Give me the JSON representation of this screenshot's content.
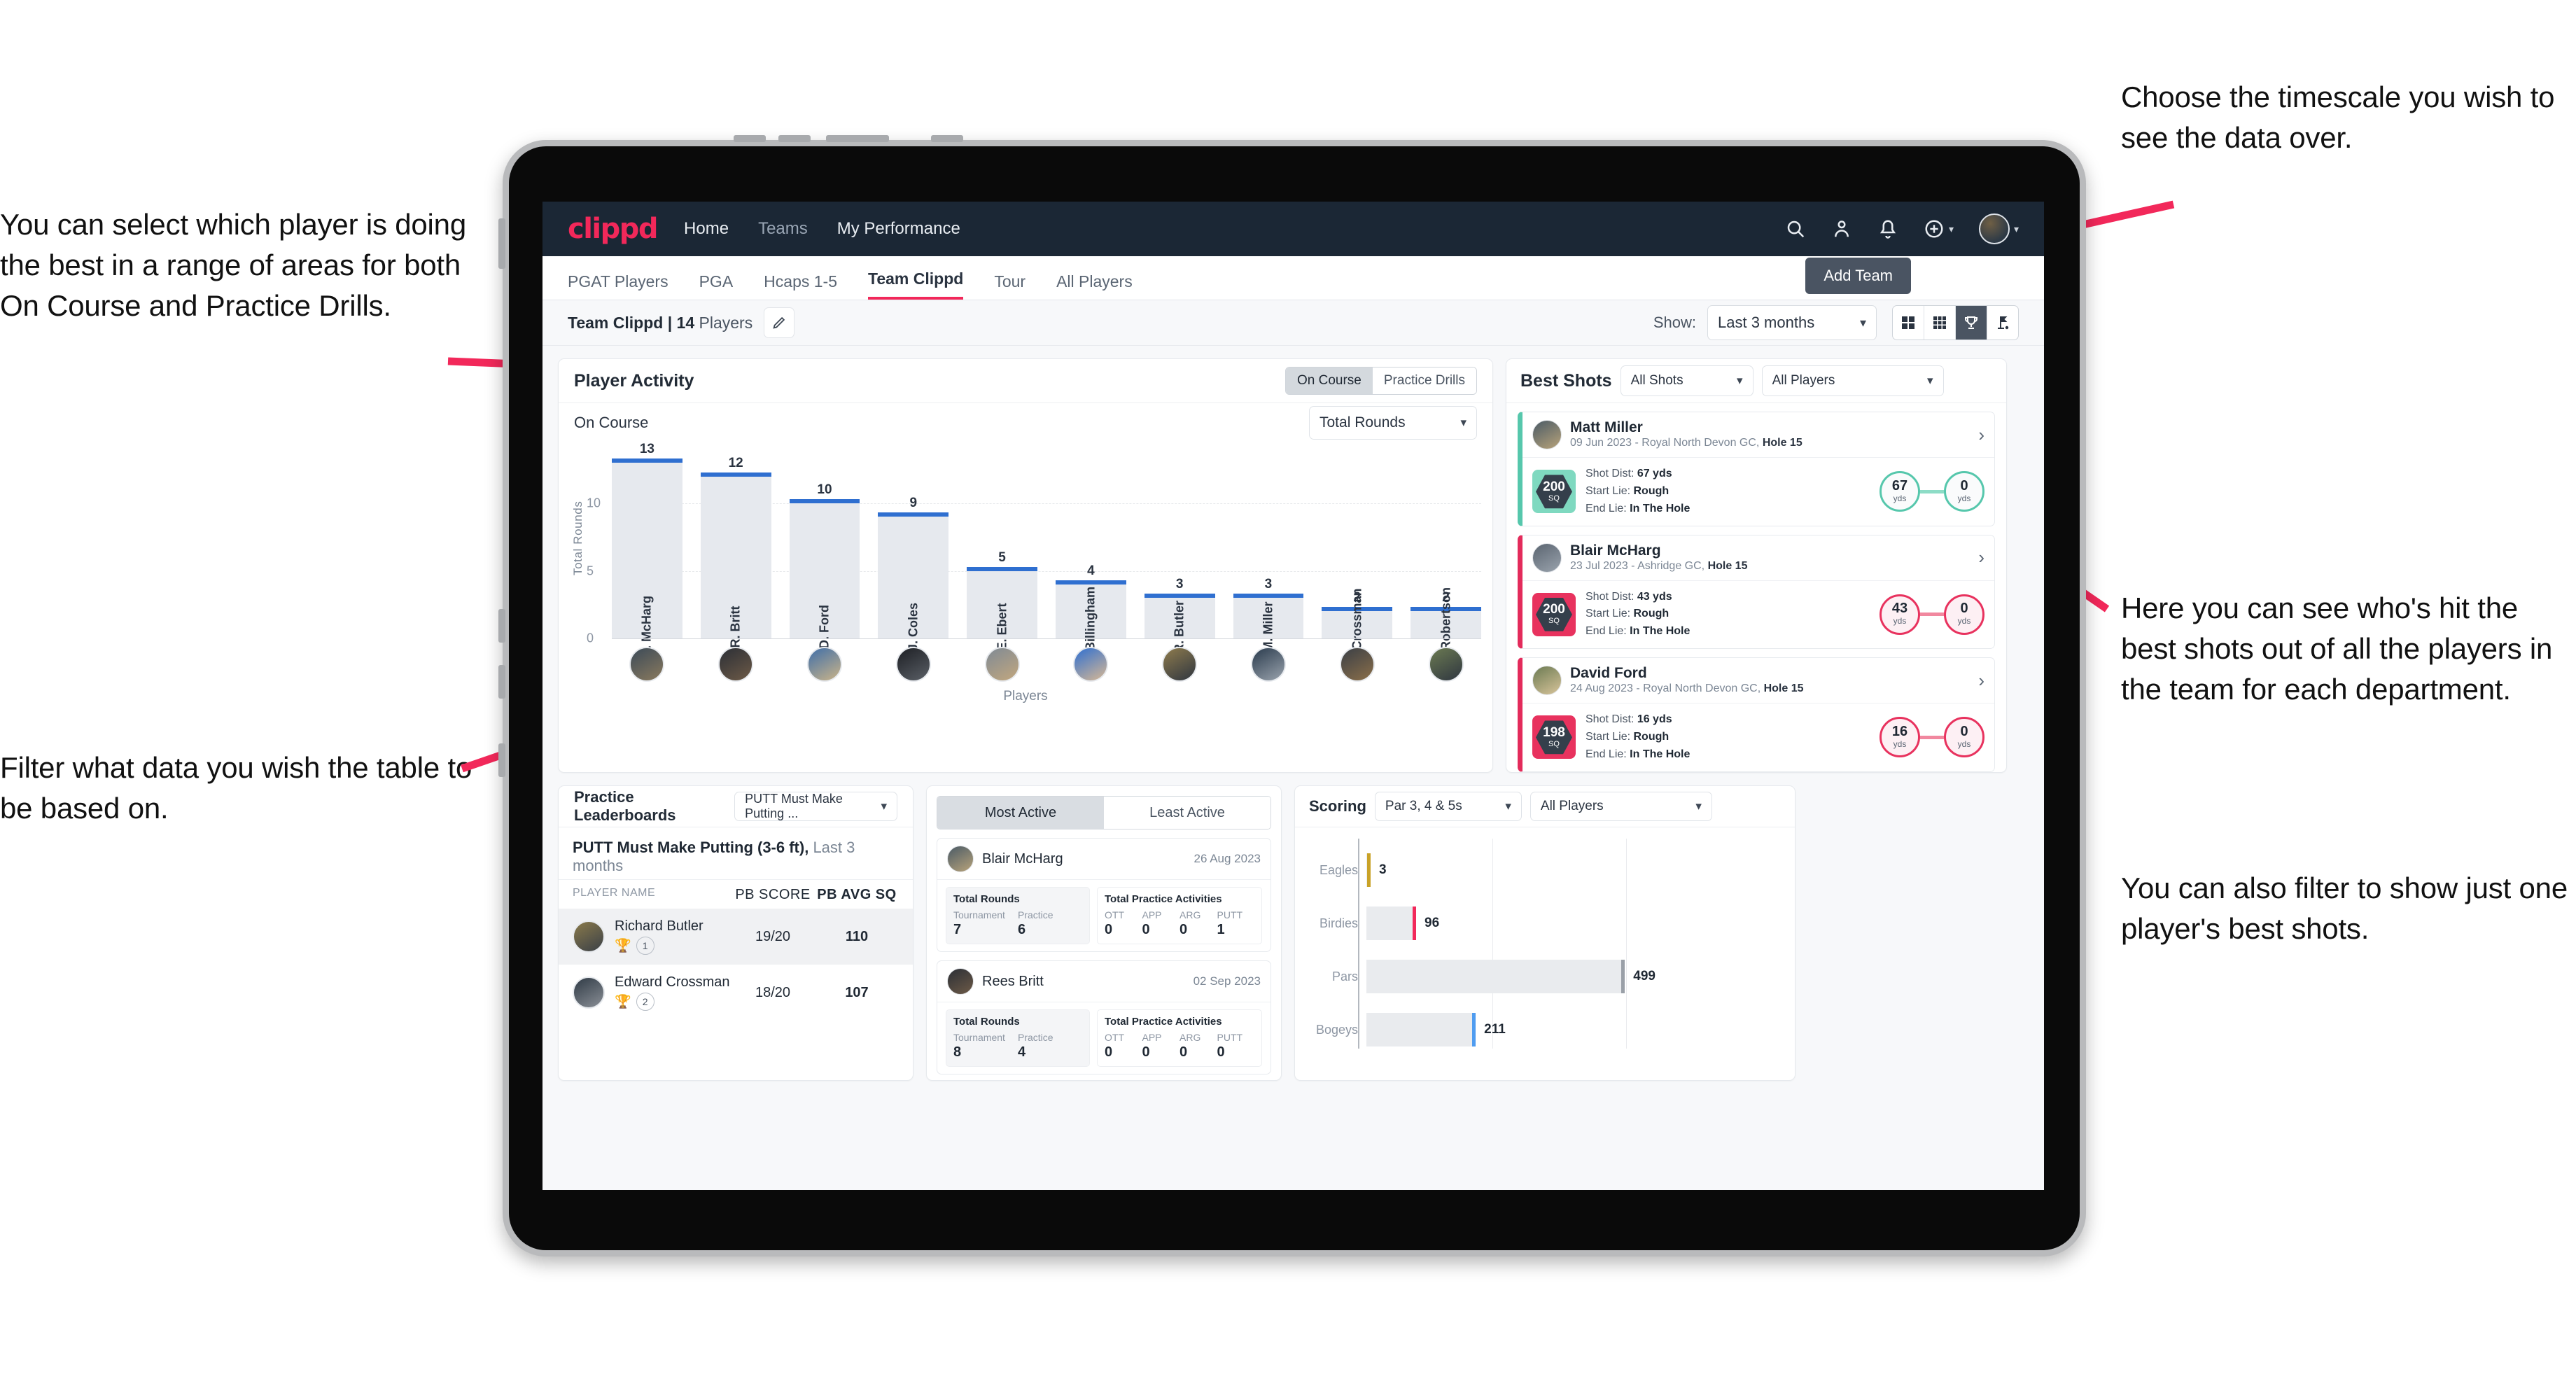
{
  "annotations": {
    "left_top": "You can select which player is doing the best in a range of areas for both On Course and Practice Drills.",
    "left_bottom": "Filter what data you wish the table to be based on.",
    "right_top": "Choose the timescale you wish to see the data over.",
    "right_mid": "Here you can see who's hit the best shots out of all the players in the team for each department.",
    "right_bottom": "You can also filter to show just one player's best shots."
  },
  "topnav": {
    "logo": "clippd",
    "links": [
      {
        "label": "Home",
        "active": true
      },
      {
        "label": "Teams",
        "active": false
      },
      {
        "label": "My Performance",
        "active": true
      }
    ],
    "icons": [
      "search-icon",
      "people-icon",
      "bell-icon",
      "plus-circle-icon",
      "avatar-icon"
    ]
  },
  "tabs": [
    {
      "label": "PGAT Players",
      "active": false
    },
    {
      "label": "PGA",
      "active": false
    },
    {
      "label": "Hcaps 1-5",
      "active": false
    },
    {
      "label": "Team Clippd",
      "active": true
    },
    {
      "label": "Tour",
      "active": false
    },
    {
      "label": "All Players",
      "active": false
    }
  ],
  "add_team_button": "Add Team",
  "team_row": {
    "team_name": "Team Clippd",
    "separator": " | ",
    "player_count": "14",
    "players_word": " Players",
    "edit_icon": "pencil-icon",
    "show_label": "Show:",
    "show_value": "Last 3 months",
    "view_toggles": [
      {
        "icon": "grid-2x2-icon",
        "active": false
      },
      {
        "icon": "grid-3x3-icon",
        "active": false
      },
      {
        "icon": "trophy-icon",
        "active": true
      },
      {
        "icon": "golf-flag-icon",
        "active": false
      }
    ]
  },
  "player_activity": {
    "title": "Player Activity",
    "segments": [
      {
        "label": "On Course",
        "active": true
      },
      {
        "label": "Practice Drills",
        "active": false
      }
    ],
    "sub_label": "On Course",
    "metric_select": "Total Rounds"
  },
  "chart_data": [
    {
      "type": "bar",
      "title": "Player Activity - On Course",
      "xlabel": "Players",
      "ylabel": "Total Rounds",
      "ylim": [
        0,
        13.9
      ],
      "yticks": [
        0,
        5,
        10
      ],
      "grid": true,
      "categories": [
        "B. McHarg",
        "R. Britt",
        "D. Ford",
        "J. Coles",
        "E. Ebert",
        "D. Billingham",
        "R. Butler",
        "M. Miller",
        "E. Crossman",
        "C. Robertson"
      ],
      "values": [
        13,
        12,
        10,
        9,
        5,
        4,
        3,
        3,
        2,
        2
      ]
    },
    {
      "type": "bar",
      "title": "Scoring",
      "orientation": "horizontal",
      "categories": [
        "Eagles",
        "Birdies",
        "Pars",
        "Bogeys"
      ],
      "values": [
        3,
        96,
        499,
        211
      ],
      "colors": [
        "#c9a227",
        "#f2285a",
        "#9aa0a8",
        "#4f9cf0"
      ],
      "xlim": [
        0,
        700
      ]
    }
  ],
  "best_shots": {
    "title": "Best Shots",
    "filter_shots": "All Shots",
    "filter_players": "All Players",
    "cards": [
      {
        "name": "Matt Miller",
        "meta_prefix": "09 Jun 2023 - Royal North Devon GC, ",
        "meta_hole": "Hole 15",
        "sq": "200",
        "sq_unit": "SQ",
        "accent": "teal",
        "shot_dist_label": "Shot Dist: ",
        "shot_dist": "67 yds",
        "start_lie_label": "Start Lie: ",
        "start_lie": "Rough",
        "end_lie_label": "End Lie: ",
        "end_lie": "In The Hole",
        "from_value": "67",
        "from_unit": "yds",
        "to_value": "0",
        "to_unit": "yds"
      },
      {
        "name": "Blair McHarg",
        "meta_prefix": "23 Jul 2023 - Ashridge GC, ",
        "meta_hole": "Hole 15",
        "sq": "200",
        "sq_unit": "SQ",
        "accent": "pink",
        "shot_dist_label": "Shot Dist: ",
        "shot_dist": "43 yds",
        "start_lie_label": "Start Lie: ",
        "start_lie": "Rough",
        "end_lie_label": "End Lie: ",
        "end_lie": "In The Hole",
        "from_value": "43",
        "from_unit": "yds",
        "to_value": "0",
        "to_unit": "yds"
      },
      {
        "name": "David Ford",
        "meta_prefix": "24 Aug 2023 - Royal North Devon GC, ",
        "meta_hole": "Hole 15",
        "sq": "198",
        "sq_unit": "SQ",
        "accent": "pink",
        "shot_dist_label": "Shot Dist: ",
        "shot_dist": "16 yds",
        "start_lie_label": "Start Lie: ",
        "start_lie": "Rough",
        "end_lie_label": "End Lie: ",
        "end_lie": "In The Hole",
        "from_value": "16",
        "from_unit": "yds",
        "to_value": "0",
        "to_unit": "yds"
      }
    ]
  },
  "practice_leaderboards": {
    "title": "Practice Leaderboards",
    "drill_select": "PUTT Must Make Putting ...",
    "subtitle_bold": "PUTT Must Make Putting (3-6 ft),",
    "subtitle_light": " Last 3 months",
    "columns": [
      "PLAYER NAME",
      "PB SCORE",
      "PB AVG SQ"
    ],
    "rows": [
      {
        "name": "Richard Butler",
        "rank": "1",
        "trophy": "gold",
        "pb_score": "19/20",
        "pb_avg_sq": "110"
      },
      {
        "name": "Edward Crossman",
        "rank": "2",
        "trophy": "silver",
        "pb_score": "18/20",
        "pb_avg_sq": "107"
      }
    ]
  },
  "activity": {
    "tabs": [
      {
        "label": "Most Active",
        "active": true
      },
      {
        "label": "Least Active",
        "active": false
      }
    ],
    "cards": [
      {
        "name": "Blair McHarg",
        "date": "26 Aug 2023",
        "rounds_title": "Total Rounds",
        "rounds_cols": [
          "Tournament",
          "Practice"
        ],
        "rounds_vals": [
          "7",
          "6"
        ],
        "practice_title": "Total Practice Activities",
        "practice_cols": [
          "OTT",
          "APP",
          "ARG",
          "PUTT"
        ],
        "practice_vals": [
          "0",
          "0",
          "0",
          "1"
        ]
      },
      {
        "name": "Rees Britt",
        "date": "02 Sep 2023",
        "rounds_title": "Total Rounds",
        "rounds_cols": [
          "Tournament",
          "Practice"
        ],
        "rounds_vals": [
          "8",
          "4"
        ],
        "practice_title": "Total Practice Activities",
        "practice_cols": [
          "OTT",
          "APP",
          "ARG",
          "PUTT"
        ],
        "practice_vals": [
          "0",
          "0",
          "0",
          "0"
        ]
      }
    ]
  },
  "scoring": {
    "title": "Scoring",
    "par_select": "Par 3, 4 & 5s",
    "player_select": "All Players"
  },
  "colors": {
    "brand_pink": "#f2285a",
    "nav_dark": "#1b2735",
    "bar_blue": "#2f6fd0",
    "teal": "#56c7ac"
  }
}
